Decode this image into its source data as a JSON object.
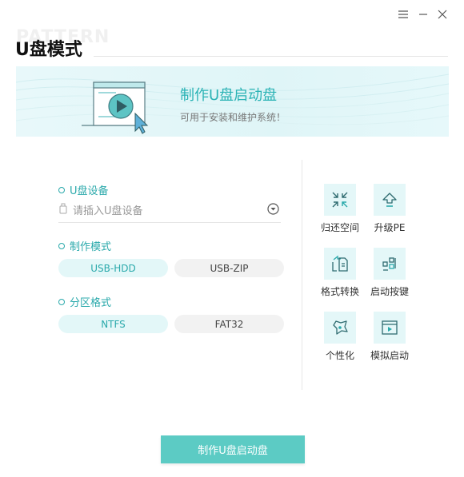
{
  "window": {
    "watermark": "PATTERN"
  },
  "page": {
    "title": "U盘模式"
  },
  "banner": {
    "title": "制作U盘启动盘",
    "subtitle": "可用于安装和维护系统！"
  },
  "device": {
    "label": "U盘设备",
    "placeholder": "请插入U盘设备"
  },
  "mode": {
    "label": "制作模式",
    "options": [
      "USB-HDD",
      "USB-ZIP"
    ],
    "selected": "USB-HDD"
  },
  "partition": {
    "label": "分区格式",
    "options": [
      "NTFS",
      "FAT32"
    ],
    "selected": "NTFS"
  },
  "tools": [
    {
      "label": "归还空间",
      "icon": "compress-icon"
    },
    {
      "label": "升级PE",
      "icon": "upgrade-icon"
    },
    {
      "label": "格式转换",
      "icon": "convert-icon"
    },
    {
      "label": "启动按键",
      "icon": "boot-key-icon"
    },
    {
      "label": "个性化",
      "icon": "personalize-icon"
    },
    {
      "label": "模拟启动",
      "icon": "simulate-boot-icon"
    }
  ],
  "actions": {
    "make_button": "制作U盘启动盘"
  },
  "colors": {
    "accent": "#2aa9ab",
    "button": "#5ccbc4",
    "tool_bg": "#e4f7f8"
  }
}
